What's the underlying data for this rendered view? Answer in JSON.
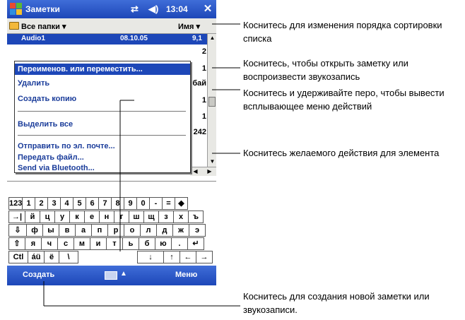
{
  "title_bar": {
    "app_title": "Заметки",
    "clock": "13:04",
    "close": "✕"
  },
  "folder_bar": {
    "folder": "Все папки ▾",
    "sort": "Имя ▾"
  },
  "list": {
    "top_row": {
      "name": "Audio1",
      "date": "08.10.05",
      "size": "9,1"
    },
    "sizes": [
      "2",
      "1",
      "бай",
      "1",
      "1",
      "242"
    ]
  },
  "context_menu": {
    "items": [
      "Переименов. или переместить...",
      "Удалить",
      "Создать копию",
      "Выделить все",
      "Отправить по эл. почте...",
      "Передать файл...",
      "Send via Bluetooth..."
    ]
  },
  "keyboard": {
    "row1": [
      "123",
      "1",
      "2",
      "3",
      "4",
      "5",
      "6",
      "7",
      "8",
      "9",
      "0",
      "-",
      "=",
      "◆"
    ],
    "row2": [
      "→|",
      "й",
      "ц",
      "у",
      "к",
      "е",
      "н",
      "г",
      "ш",
      "щ",
      "з",
      "х",
      "ъ"
    ],
    "row3": [
      "⇩",
      "ф",
      "ы",
      "в",
      "а",
      "п",
      "р",
      "о",
      "л",
      "д",
      "ж",
      "э"
    ],
    "row4": [
      "⇧",
      "я",
      "ч",
      "с",
      "м",
      "и",
      "т",
      "ь",
      "б",
      "ю",
      ".",
      "↵"
    ],
    "row5": [
      "Ctl",
      "áü",
      "ё",
      "\\",
      "↓",
      "↑",
      "←",
      "→"
    ]
  },
  "menu_bar": {
    "left": "Создать",
    "right": "Меню"
  },
  "callouts": {
    "sort": "Коснитесь для изменения порядка сортировки списка",
    "open": "Коснитесь, чтобы открыть заметку или воспроизвести звукозапись",
    "hold": "Коснитесь и удерживайте перо, чтобы вывести всплывающее меню действий",
    "action": "Коснитесь желаемого действия для элемента",
    "create": "Коснитесь для создания новой заметки или звукозаписи."
  }
}
